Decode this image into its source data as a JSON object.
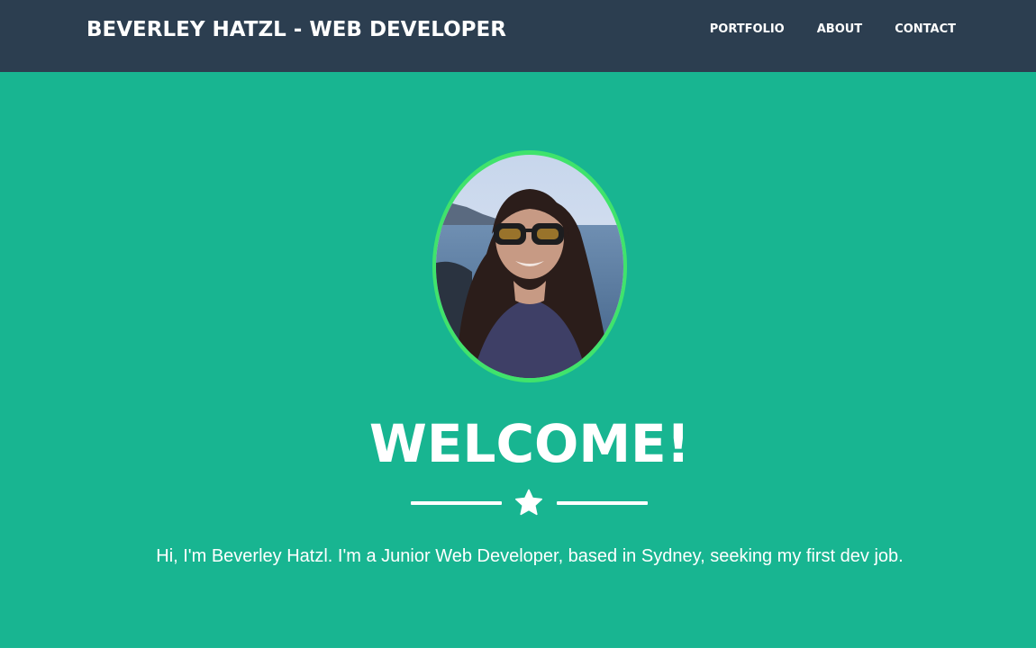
{
  "navbar": {
    "brand": "BEVERLEY HATZL - WEB DEVELOPER",
    "links": [
      {
        "label": "PORTFOLIO"
      },
      {
        "label": "ABOUT"
      },
      {
        "label": "CONTACT"
      }
    ]
  },
  "masthead": {
    "heading": "WELCOME!",
    "divider_icon": "star-icon",
    "intro": "Hi, I'm Beverley Hatzl. I'm a Junior Web Developer, based in Sydney, seeking my first dev job."
  },
  "colors": {
    "navbar_bg": "#2c3e50",
    "masthead_bg": "#18b591",
    "avatar_border": "#40e36c",
    "text": "#ffffff"
  }
}
